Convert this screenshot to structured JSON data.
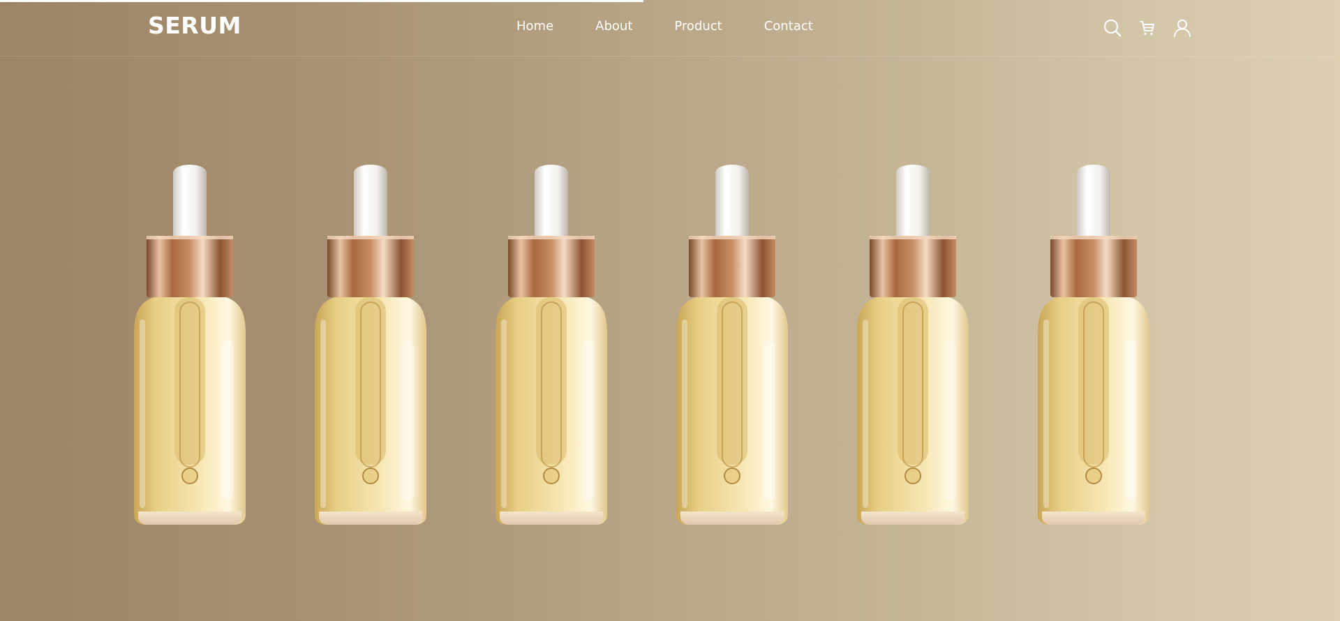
{
  "progress": {
    "value_fraction": 0.48
  },
  "brand": {
    "logo": "SERUM"
  },
  "nav": {
    "items": [
      {
        "label": "Home"
      },
      {
        "label": "About"
      },
      {
        "label": "Product"
      },
      {
        "label": "Contact"
      }
    ]
  },
  "header_icons": [
    "search-icon",
    "cart-icon",
    "user-icon"
  ],
  "gallery": {
    "bottle_count": 6,
    "colors": {
      "cap": "#f2f0ec",
      "collar": "#c88e66",
      "liquid": "#e8cf86",
      "glass": "#f7f0d8"
    }
  },
  "theme": {
    "background_start": "#9c8465",
    "background_end": "#dccfb4",
    "text": "#ffffff"
  }
}
